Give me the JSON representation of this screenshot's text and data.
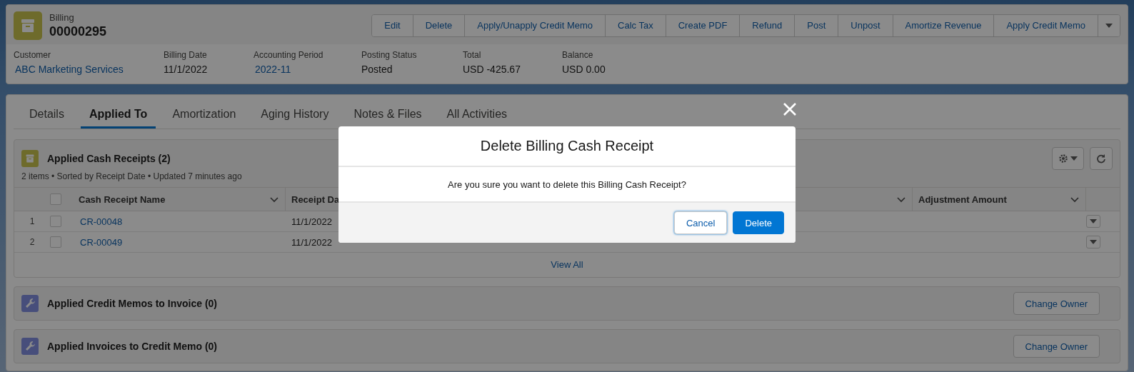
{
  "record": {
    "object_label": "Billing",
    "name": "00000295"
  },
  "actions": [
    "Edit",
    "Delete",
    "Apply/Unapply Credit Memo",
    "Calc Tax",
    "Create PDF",
    "Refund",
    "Post",
    "Unpost",
    "Amortize Revenue",
    "Apply Credit Memo"
  ],
  "fields": [
    {
      "label": "Customer",
      "value": "ABC Marketing Services",
      "kind": "link"
    },
    {
      "label": "Billing Date",
      "value": "11/1/2022",
      "kind": "text"
    },
    {
      "label": "Accounting Period",
      "value": "2022-11",
      "kind": "link"
    },
    {
      "label": "Posting Status",
      "value": "Posted",
      "kind": "text"
    },
    {
      "label": "Total",
      "value": "USD -425.67",
      "kind": "text"
    },
    {
      "label": "Balance",
      "value": "USD 0.00",
      "kind": "text"
    }
  ],
  "tabs": [
    {
      "label": "Details",
      "selected": false
    },
    {
      "label": "Applied To",
      "selected": true
    },
    {
      "label": "Amortization",
      "selected": false
    },
    {
      "label": "Aging History",
      "selected": false
    },
    {
      "label": "Notes & Files",
      "selected": false
    },
    {
      "label": "All Activities",
      "selected": false
    }
  ],
  "related_lists": [
    {
      "kind": "table",
      "title": "Applied Cash Receipts (2)",
      "meta": "2 items • Sorted by Receipt Date • Updated 7 minutes ago",
      "all_checked": false,
      "columns": [
        "Cash Receipt Name",
        "Receipt Da",
        "Adjustment Amount"
      ],
      "rows": [
        {
          "number": "1",
          "checked": false,
          "name": "CR-00048",
          "receipt_date": "11/1/2022"
        },
        {
          "number": "2",
          "checked": false,
          "name": "CR-00049",
          "receipt_date": "11/1/2022"
        }
      ],
      "footer_link": "View All"
    },
    {
      "kind": "empty",
      "title": "Applied Credit Memos to Invoice (0)",
      "button": "Change Owner"
    },
    {
      "kind": "empty",
      "title": "Applied Invoices to Credit Memo (0)",
      "button": "Change Owner"
    }
  ],
  "dialog": {
    "title": "Delete Billing Cash Receipt",
    "message": "Are you sure you want to delete this Billing Cash Receipt?",
    "buttons": [
      {
        "label": "Cancel",
        "kind": "neutral"
      },
      {
        "label": "Delete",
        "kind": "brand"
      }
    ]
  }
}
